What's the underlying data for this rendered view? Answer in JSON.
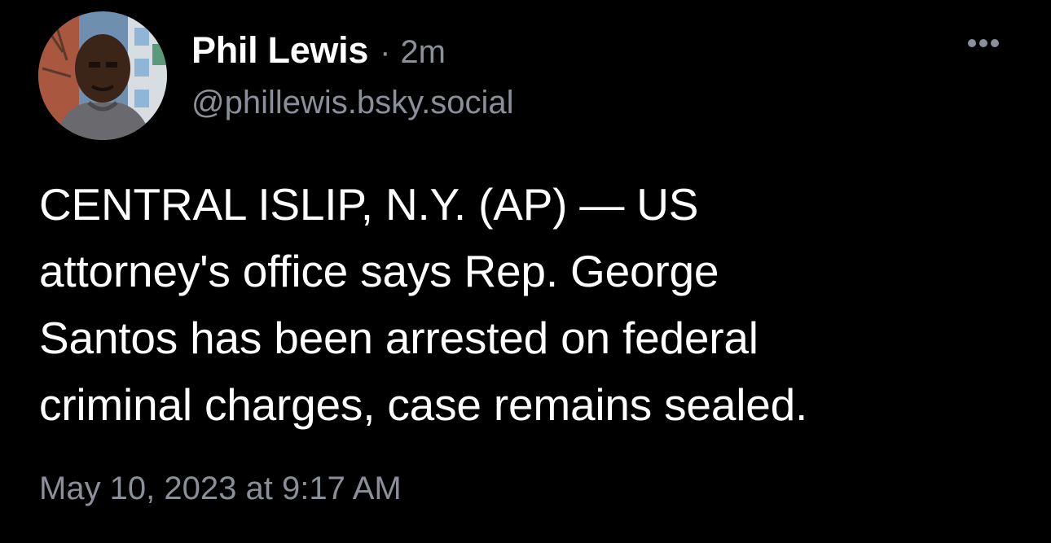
{
  "post": {
    "author": {
      "display_name": "Phil Lewis",
      "separator": "·",
      "time_ago": "2m",
      "handle": "@phillewis.bsky.social",
      "avatar_icon": "avatar-photo"
    },
    "more_icon": "ellipsis-icon",
    "text": "CENTRAL ISLIP, N.Y. (AP) — US\nattorney's office says Rep. George\nSantos has been arrested on federal\ncriminal charges, case remains sealed.",
    "timestamp": "May 10, 2023 at 9:17 AM"
  },
  "colors": {
    "background": "#000000",
    "primary_text": "#ffffff",
    "secondary_text": "#8b8f99"
  }
}
